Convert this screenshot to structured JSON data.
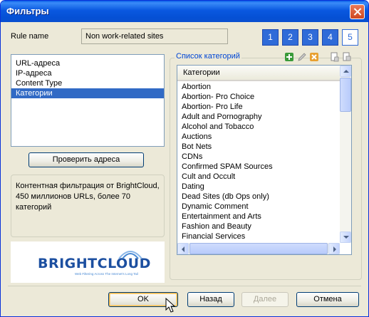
{
  "window": {
    "title": "Фильтры"
  },
  "rule": {
    "label": "Rule name",
    "value": "Non work-related sites"
  },
  "steps": [
    "1",
    "2",
    "3",
    "4",
    "5"
  ],
  "filters": {
    "items": [
      "URL-адреса",
      "IP-адреса",
      "Content Type",
      "Категории"
    ],
    "selected": "Категории"
  },
  "check_button": "Проверить адреса",
  "description": "Контентная фильтрация от BrightCloud, 450 миллионов URLs, более 70 категорий",
  "logo": {
    "text_bright": "BRIGHT",
    "text_cloud": "CLOUD",
    "tagline": "Web Filtering Across The Internet's Long Tail"
  },
  "categories_group": {
    "title": "Список категорий",
    "column_header": "Категории",
    "items": [
      "Abortion",
      "Abortion- Pro Choice",
      "Abortion- Pro Life",
      "Adult and Pornography",
      "Alcohol and Tobacco",
      "Auctions",
      "Bot Nets",
      "CDNs",
      "Confirmed SPAM Sources",
      "Cult and Occult",
      "Dating",
      "Dead Sites (db Ops only)",
      "Dynamic Comment",
      "Entertainment and Arts",
      "Fashion and Beauty",
      "Financial Services"
    ]
  },
  "buttons": {
    "ok": "OK",
    "back": "Назад",
    "next": "Далее",
    "cancel": "Отмена"
  },
  "colors": {
    "accent": "#316ac5",
    "title_bar": "#0a58e0",
    "step_active": "#2f6bd8"
  }
}
